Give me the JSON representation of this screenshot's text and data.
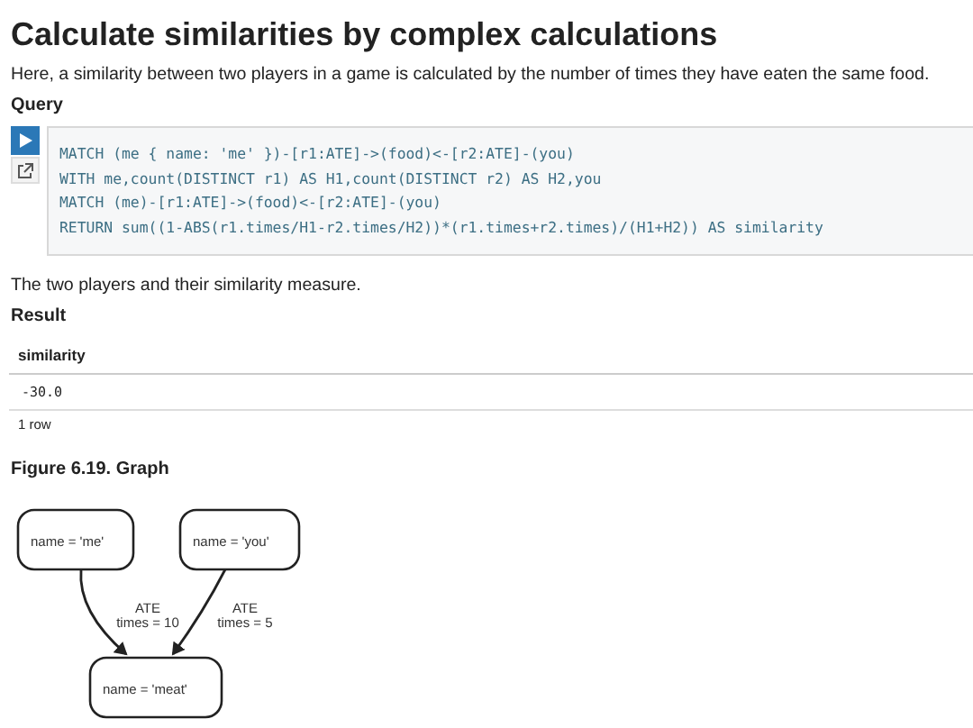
{
  "title": "Calculate similarities by complex calculations",
  "description": "Here, a similarity between two players in a game is calculated by the number of times they have eaten the same food.",
  "query": {
    "heading": "Query",
    "lines": [
      "MATCH (me { name: 'me' })-[r1:ATE]->(food)<-[r2:ATE]-(you)",
      "WITH me,count(DISTINCT r1) AS H1,count(DISTINCT r2) AS H2,you",
      "MATCH (me)-[r1:ATE]->(food)<-[r2:ATE]-(you)",
      "RETURN sum((1-ABS(r1.times/H1-r2.times/H2))*(r1.times+r2.times)/(H1+H2)) AS similarity"
    ]
  },
  "caption": "The two players and their similarity measure.",
  "result": {
    "heading": "Result",
    "columns": [
      "similarity"
    ],
    "rows": [
      [
        "-30.0"
      ]
    ],
    "footer": "1 row"
  },
  "figure": {
    "title": "Figure 6.19. Graph",
    "nodes": [
      {
        "label": "name = 'me'"
      },
      {
        "label": "name = 'you'"
      },
      {
        "label": "name = 'meat'"
      }
    ],
    "edges": [
      {
        "type": "ATE",
        "props": "times = 10"
      },
      {
        "type": "ATE",
        "props": "times = 5"
      }
    ]
  }
}
